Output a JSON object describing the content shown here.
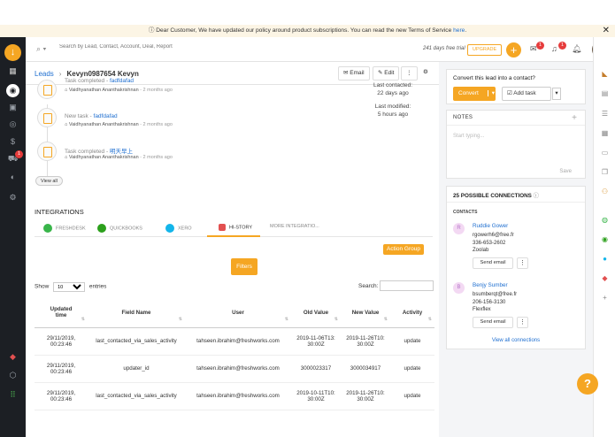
{
  "banner": {
    "text": "Dear Customer, We have updated our policy around product subscriptions. You can read the new Terms of Service",
    "link": "here",
    "suffix": "."
  },
  "topbar": {
    "search_placeholder": "Search by Lead, Contact, Account, Deal, Report",
    "trial": "241 days free trial",
    "upgrade": "UPGRADE",
    "mail_count": "1",
    "bell_count": "1"
  },
  "left_nav": {
    "badge": "1"
  },
  "header": {
    "breadcrumb_root": "Leads",
    "lead_name": "Kevyn0987654 Kevyn",
    "email_btn": "Email",
    "edit_btn": "Edit"
  },
  "timeline": {
    "items": [
      {
        "prefix": "Task completed - ",
        "name": "fadfdafad",
        "user": "Vaidhyanathan Ananthakrishnan",
        "ago": "2 months ago"
      },
      {
        "prefix": "New task - ",
        "name": "fadfdafad",
        "user": "Vaidhyanathan Ananthakrishnan",
        "ago": "2 months ago"
      },
      {
        "prefix": "Task completed - ",
        "name": "明天早上",
        "user": "Vaidhyanathan Ananthakrishnan",
        "ago": "2 months ago"
      }
    ],
    "view_all": "View all"
  },
  "last_info": {
    "contacted_label": "Last contacted:",
    "contacted_value": "22 days ago",
    "modified_label": "Last modified:",
    "modified_value": "5 hours ago"
  },
  "integrations": {
    "title": "INTEGRATIONS",
    "tabs": [
      "FRESHDESK",
      "QUICKBOOKS",
      "XERO",
      "HI-STORY",
      "MORE INTEGRATIO..."
    ],
    "action_group": "Action Group",
    "filters": "Filters",
    "show_label": "Show",
    "show_value": "10",
    "entries_label": "entries",
    "search_label": "Search:"
  },
  "table": {
    "headers": [
      "Updated time",
      "Field Name",
      "User",
      "Old Value",
      "New Value",
      "Activity"
    ],
    "rows": [
      {
        "time": "29/11/2019, 00:23:46",
        "field": "last_contacted_via_sales_activity",
        "user": "tahseen.ibrahim@freshworks.com",
        "old": "2019-11-06T13:30:00Z",
        "new": "2019-11-26T10:30:00Z",
        "activity": "update"
      },
      {
        "time": "29/11/2019, 00:23:46",
        "field": "updater_id",
        "user": "tahseen.ibrahim@freshworks.com",
        "old": "3000023317",
        "new": "3000034917",
        "activity": "update"
      },
      {
        "time": "29/11/2019, 00:23:46",
        "field": "last_contacted_via_sales_activity",
        "user": "tahseen.ibrahim@freshworks.com",
        "old": "2019-10-11T10:30:00Z",
        "new": "2019-11-26T10:30:00Z",
        "activity": "update"
      }
    ]
  },
  "convert_panel": {
    "title": "Convert this lead into a contact?",
    "convert": "Convert",
    "add_task": "Add task"
  },
  "notes": {
    "title": "NOTES",
    "placeholder": "Start typing...",
    "save": "Save"
  },
  "connections": {
    "title": "25 POSSIBLE CONNECTIONS",
    "label": "CONTACTS",
    "contacts": [
      {
        "initial": "R",
        "name": "Ruddie Gower",
        "email": "rgowerh6@free.fr",
        "phone": "336-653-2602",
        "company": "Zoolab",
        "send": "Send email"
      },
      {
        "initial": "B",
        "name": "Benjy Sumber",
        "email": "bsumberqt@free.fr",
        "phone": "206-156-3130",
        "company": "Flexflex",
        "send": "Send email"
      }
    ],
    "view_all": "View all connections"
  },
  "help": "?"
}
